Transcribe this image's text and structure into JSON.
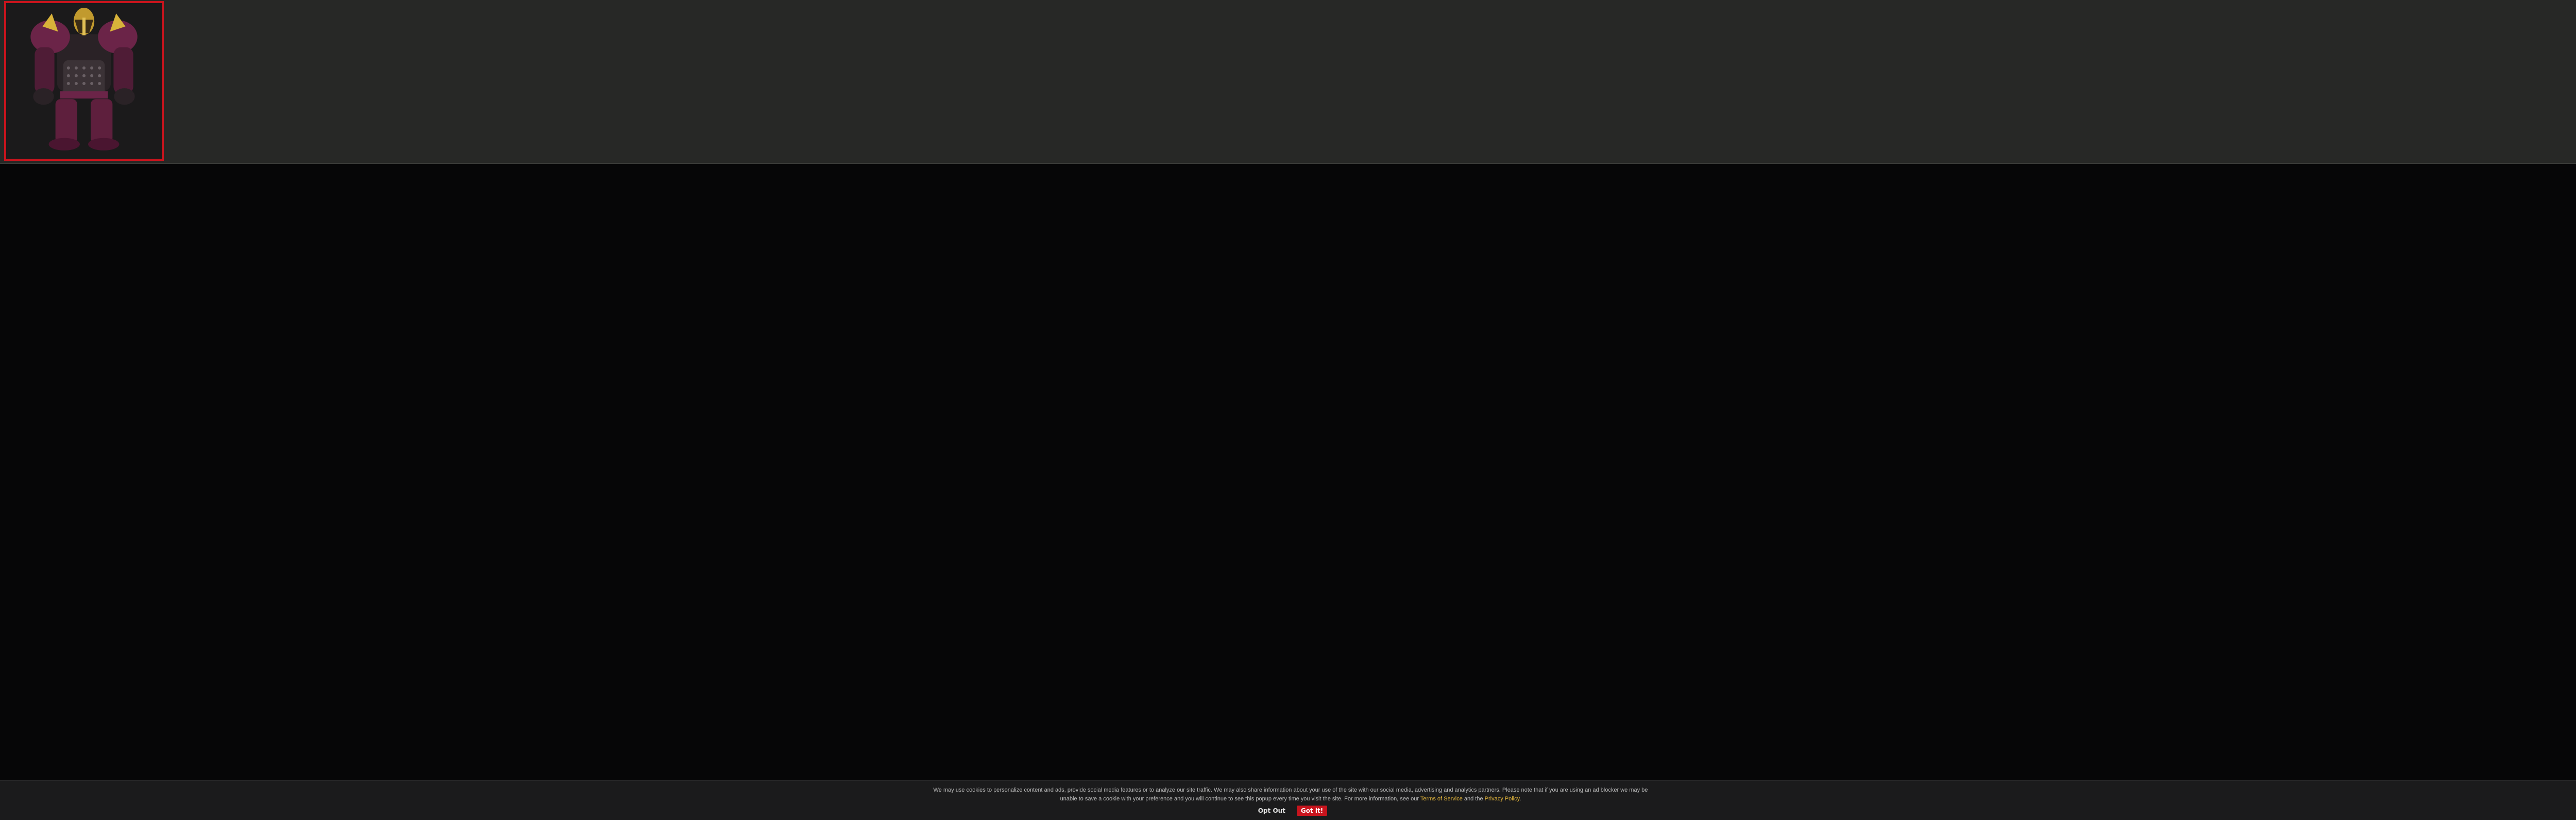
{
  "viewer": {
    "thumbnail_alt": "3D armor model preview",
    "accent_color": "#c8141d",
    "strip_color": "#272826",
    "page_color": "#060607"
  },
  "cookie_banner": {
    "text_part1": "We may use cookies to personalize content and ads, provide social media features or to analyze our site traffic. We may also share information about your use of the site with our social media, advertising and analytics partners. Please note that if you are using an ad blocker we may be unable to save a cookie with your preference and you will continue to see this popup every time you visit the site. For more information, see our",
    "terms_link": "Terms of Service",
    "and_text": "and the",
    "privacy_link": "Privacy Policy",
    "period": ".",
    "opt_out_label": "Opt Out",
    "got_it_label": "Got it!",
    "link_color": "#e5b73b",
    "button_color": "#c8141d"
  }
}
